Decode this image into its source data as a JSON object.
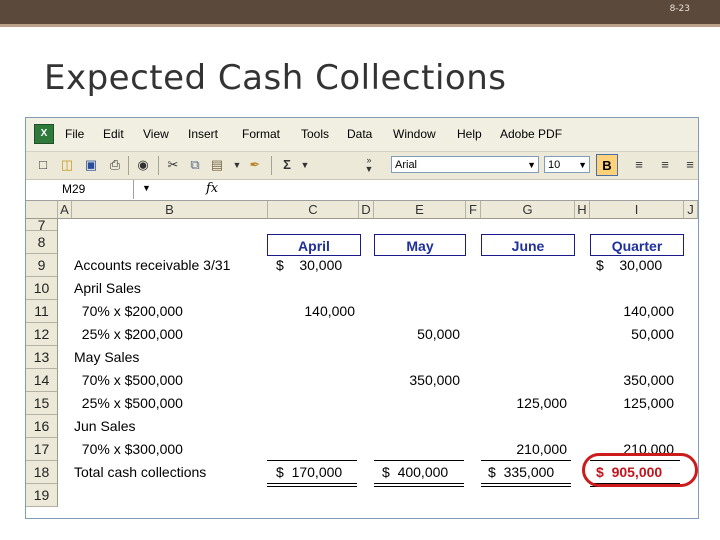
{
  "slide": {
    "number": "8-23",
    "title": "Expected Cash Collections"
  },
  "colors": {
    "header_text": "#1f2f9c",
    "highlight": "#cc1b1b",
    "topbar": "#5b4a3c"
  },
  "excel": {
    "menu": [
      "File",
      "Edit",
      "View",
      "Insert",
      "Format",
      "Tools",
      "Data",
      "Window",
      "Help",
      "Adobe PDF"
    ],
    "toolbar": {
      "icons": [
        "new-icon",
        "open-icon",
        "save-icon",
        "print-icon",
        "preview-icon",
        "cut-icon",
        "copy-icon",
        "paste-icon",
        "format-painter-icon",
        "autosum-icon"
      ],
      "autosum": "Σ",
      "font": "Arial",
      "size": "10",
      "bold": "B"
    },
    "namebox": "M29",
    "fx": "fx",
    "columns": [
      "A",
      "B",
      "C",
      "D",
      "E",
      "F",
      "G",
      "H",
      "I",
      "J"
    ],
    "rows": [
      "7",
      "8",
      "9",
      "10",
      "11",
      "12",
      "13",
      "14",
      "15",
      "16",
      "17",
      "18",
      "19"
    ],
    "headers": {
      "april": "April",
      "may": "May",
      "june": "June",
      "quarter": "Quarter"
    },
    "lines": [
      {
        "label": "Accounts receivable 3/31",
        "april": "$    30,000",
        "may": "",
        "june": "",
        "quarter": "$    30,000"
      },
      {
        "label": "April Sales",
        "april": "",
        "may": "",
        "june": "",
        "quarter": ""
      },
      {
        "label": "  70% x $200,000",
        "april": "140,000",
        "may": "",
        "june": "",
        "quarter": "140,000"
      },
      {
        "label": "  25% x $200,000",
        "april": "",
        "may": "50,000",
        "june": "",
        "quarter": "50,000"
      },
      {
        "label": "May Sales",
        "april": "",
        "may": "",
        "june": "",
        "quarter": ""
      },
      {
        "label": "  70% x $500,000",
        "april": "",
        "may": "350,000",
        "june": "",
        "quarter": "350,000"
      },
      {
        "label": "  25% x $500,000",
        "april": "",
        "may": "",
        "june": "125,000",
        "quarter": "125,000"
      },
      {
        "label": "Jun Sales",
        "april": "",
        "may": "",
        "june": "",
        "quarter": ""
      },
      {
        "label": "  70% x $300,000",
        "april": "",
        "may": "",
        "june": "210,000",
        "quarter": "210,000"
      },
      {
        "label": "Total cash collections",
        "april": "$  170,000",
        "may": "$  400,000",
        "june": "$  335,000",
        "quarter": "$  905,000"
      }
    ]
  }
}
